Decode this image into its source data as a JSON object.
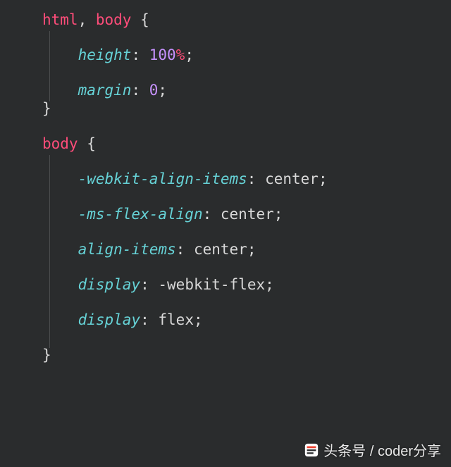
{
  "code": {
    "rule1": {
      "sel1": "html",
      "comma": ", ",
      "sel2": "body",
      "space": " ",
      "brace_o": "{",
      "decl1": {
        "prop": "height",
        "colon": ": ",
        "num": "100",
        "unit": "%",
        "semi": ";"
      },
      "decl2": {
        "prop": "margin",
        "colon": ": ",
        "num": "0",
        "semi": ";"
      },
      "brace_c": "}"
    },
    "rule2": {
      "sel1": "body",
      "space": " ",
      "brace_o": "{",
      "decl1": {
        "prop": "-webkit-align-items",
        "colon": ": ",
        "val": "center",
        "semi": ";"
      },
      "decl2": {
        "prop": "-ms-flex-align",
        "colon": ": ",
        "val": "center",
        "semi": ";"
      },
      "decl3": {
        "prop": "align-items",
        "colon": ": ",
        "val": "center",
        "semi": ";"
      },
      "decl4": {
        "prop": "display",
        "colon": ": ",
        "val": "-webkit-flex",
        "semi": ";"
      },
      "decl5": {
        "prop": "display",
        "colon": ": ",
        "val": "flex",
        "semi": ";"
      },
      "brace_c": "}"
    }
  },
  "watermark": {
    "text": "头条号 / coder分享"
  }
}
